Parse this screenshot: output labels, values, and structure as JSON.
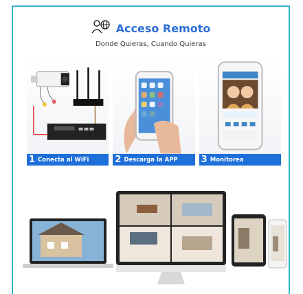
{
  "header": {
    "title": "Acceso Remoto",
    "subtitle": "Donde Quieras, Cuando Quieras",
    "icon": "user-globe-icon"
  },
  "steps": [
    {
      "number": "1",
      "label": "Conecta al WiFi"
    },
    {
      "number": "2",
      "label": "Descarga la APP"
    },
    {
      "number": "3",
      "label": "Monitorea"
    }
  ],
  "colors": {
    "accent": "#2f6fd6",
    "step_bar": "#1e6fd9",
    "frame": "#2fb3c9"
  }
}
